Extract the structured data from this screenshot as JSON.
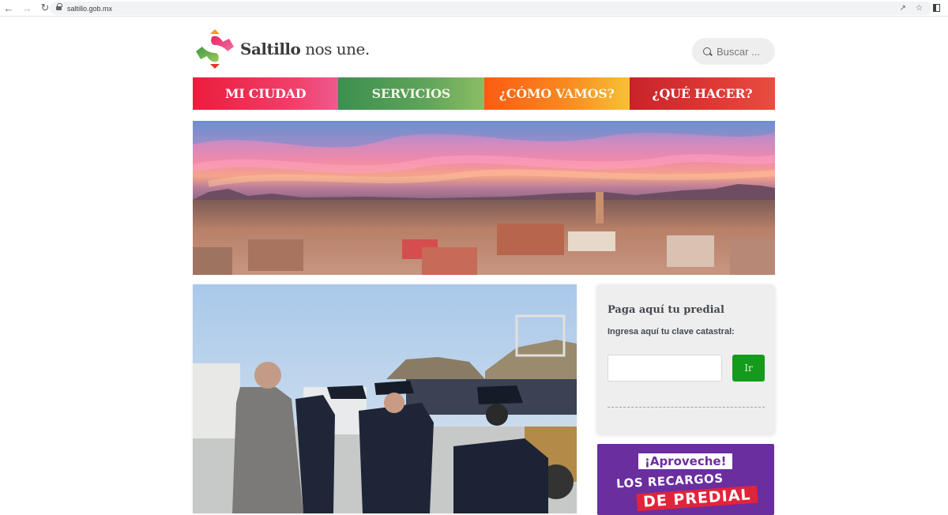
{
  "browser": {
    "url": "saltillo.gob.mx",
    "icons": [
      "back-arrow-icon",
      "forward-arrow-icon",
      "reload-icon",
      "lock-icon",
      "share-icon",
      "star-icon",
      "side-panel-icon"
    ]
  },
  "header": {
    "brand_bold": "Saltillo",
    "brand_rest": " nos une.",
    "search_placeholder": "Buscar ..."
  },
  "nav": {
    "items": [
      {
        "label": "MI CIUDAD",
        "color": "#ec1c3c"
      },
      {
        "label": "SERVICIOS",
        "color": "#4a9652"
      },
      {
        "label": "¿CÓMO VAMOS?",
        "color": "#fb6d17"
      },
      {
        "label": "¿QUÉ HACER?",
        "color": "#d52e30"
      }
    ]
  },
  "hero": {
    "description": "Panoramic aerial view of Saltillo at sunset with pink clouds and mountains"
  },
  "news": {
    "description": "Officials greeting police officers in uniform at an outdoor event"
  },
  "predial": {
    "title": "Paga aquí tu predial",
    "label": "Ingresa aquí tu clave catastral:",
    "input_value": "",
    "button_label": "Ir",
    "button_color": "#159b1b"
  },
  "promo": {
    "tag": "¡Aproveche!",
    "line1": "LOS RECARGOS",
    "line2": "DE PREDIAL",
    "bg_color": "#6a2e9e"
  }
}
